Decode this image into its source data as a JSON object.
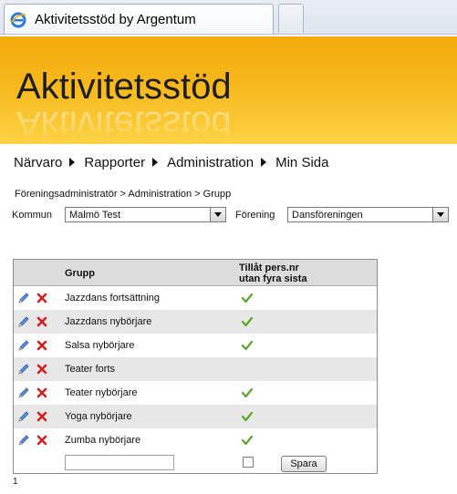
{
  "browser": {
    "tab_title": "Aktivitetsstöd by Argentum"
  },
  "banner": {
    "logo_text": "Aktivitetsstöd"
  },
  "nav": {
    "items": [
      "Närvaro",
      "Rapporter",
      "Administration",
      "Min Sida"
    ]
  },
  "breadcrumb": "Föreningsadministratör > Administration > Grupp",
  "filters": {
    "kommun_label": "Kommun",
    "kommun_value": "Malmö Test",
    "forening_label": "Förening",
    "forening_value": "Dansföreningen"
  },
  "grid": {
    "col_group": "Grupp",
    "col_allow_line1": "Tillåt pers.nr",
    "col_allow_line2": "utan fyra sista",
    "rows": [
      {
        "name": "Jazzdans fortsättning",
        "allowed": true
      },
      {
        "name": "Jazzdans nybörjare",
        "allowed": true
      },
      {
        "name": "Salsa nybörjare",
        "allowed": true
      },
      {
        "name": "Teater forts",
        "allowed": false
      },
      {
        "name": "Teater nybörjare",
        "allowed": true
      },
      {
        "name": "Yoga nybörjare",
        "allowed": true
      },
      {
        "name": "Zumba nybörjare",
        "allowed": true
      }
    ],
    "new_group_value": "",
    "save_label": "Spara"
  },
  "pager": {
    "page": "1"
  },
  "colors": {
    "banner_top": "#f3a90a",
    "banner_bottom": "#fcd243",
    "row_alt": "#e7e7e7",
    "check_green": "#5aa82a",
    "delete_red": "#d21f1f",
    "edit_blue": "#3a6fc4"
  }
}
